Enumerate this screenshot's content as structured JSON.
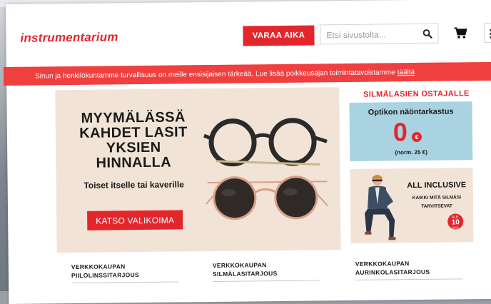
{
  "header": {
    "logo_text": "instrumentarium",
    "book_button": "VARAA AIKA",
    "search_placeholder": "Etsi sivustolta...",
    "icons": [
      "search-icon",
      "cart-icon",
      "menu-icon"
    ]
  },
  "notice": {
    "text": "Sinun ja henkilökuntamme turvallisuus on meille ensisijaisen tärkeää. Lue lisää poikkeusajan toimintatavoistamme",
    "link": "täältä"
  },
  "hero": {
    "title_lines": [
      "MYYMÄLÄSSÄ",
      "KAHDET LASIT",
      "YKSIEN",
      "HINNALLA"
    ],
    "subtitle": "Toiset itselle tai kaverille",
    "button": "KATSO VALIKOIMA"
  },
  "sidebar": {
    "title": "SILMÄLASIEN OSTAJALLE",
    "card1": {
      "heading": "Optikon näöntarkastus",
      "price": "0",
      "currency": "€",
      "note": "(norm. 25 €)"
    },
    "card2": {
      "heading": "ALL INCLUSIVE",
      "subline1": "KAIKKI MITÄ SILMÄSI",
      "subline2": "TARVITSEVAT",
      "badge_top": "ALK.",
      "badge_value": "10",
      "badge_unit": "€/KK"
    }
  },
  "footer_links": [
    {
      "line1": "VERKKOKAUPAN",
      "line2": "PIILOLINSSITARJOUS"
    },
    {
      "line1": "VERKKOKAUPAN",
      "line2": "SILMÄLASITARJOUS"
    },
    {
      "line1": "VERKKOKAUPAN",
      "line2": "AURINKOLASITARJOUS"
    }
  ],
  "colors": {
    "brand_red": "#e3262c",
    "notice_red": "#ef3f3e",
    "hero_beige": "#f1e4d6",
    "card_blue": "#a9d3e0"
  }
}
